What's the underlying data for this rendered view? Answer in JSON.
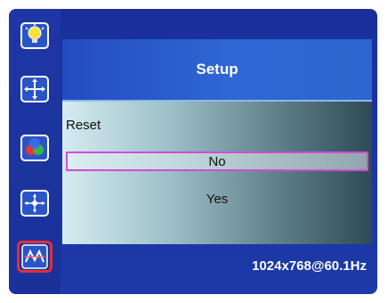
{
  "sidebar": {
    "icons": [
      {
        "name": "brightness-bulb-icon",
        "selected": false
      },
      {
        "name": "position-move-icon",
        "selected": false
      },
      {
        "name": "color-balls-icon",
        "selected": false
      },
      {
        "name": "size-arrows-icon",
        "selected": false
      },
      {
        "name": "setup-tools-icon",
        "selected": true
      }
    ]
  },
  "panel": {
    "title": "Setup",
    "item_label": "Reset",
    "options": [
      {
        "label": "No",
        "selected": true
      },
      {
        "label": "Yes",
        "selected": false
      }
    ]
  },
  "status": {
    "resolution": "1024x768@60.1Hz"
  },
  "colors": {
    "osd_background": "#1d3aa8",
    "header": "#2f67d4",
    "selection_border": "#d04cd8",
    "selected_icon_border": "#e0303a"
  }
}
